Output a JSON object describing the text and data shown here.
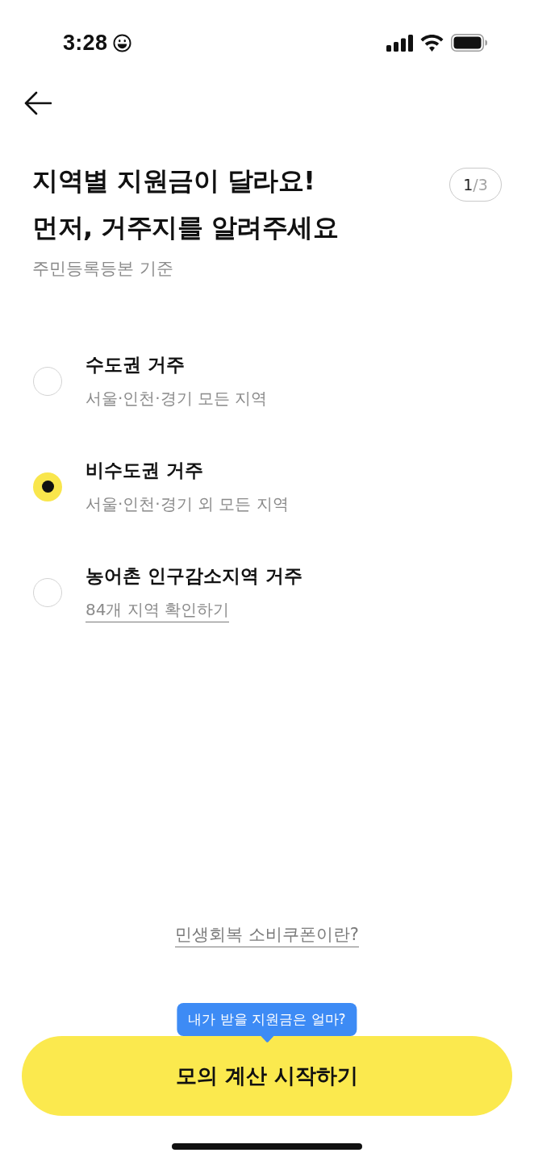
{
  "status_bar": {
    "time": "3:28"
  },
  "header": {
    "title": "지역별 지원금이 달라요!\n먼저, 거주지를 알려주세요",
    "step": {
      "current": "1",
      "total": "/3"
    },
    "subtitle": "주민등록등본 기준"
  },
  "options": [
    {
      "label": "수도권 거주",
      "detail": "서울·인천·경기 모든 지역",
      "kind": "text",
      "selected": false
    },
    {
      "label": "비수도권 거주",
      "detail": "서울·인천·경기 외 모든 지역",
      "kind": "text",
      "selected": true
    },
    {
      "label": "농어촌 인구감소지역 거주",
      "detail": "84개 지역 확인하기",
      "kind": "link",
      "selected": false
    }
  ],
  "info_link": "민생회복 소비쿠폰이란?",
  "tooltip": "내가 받을 지원금은 얼마?",
  "primary_button": "모의 계산 시작하기"
}
